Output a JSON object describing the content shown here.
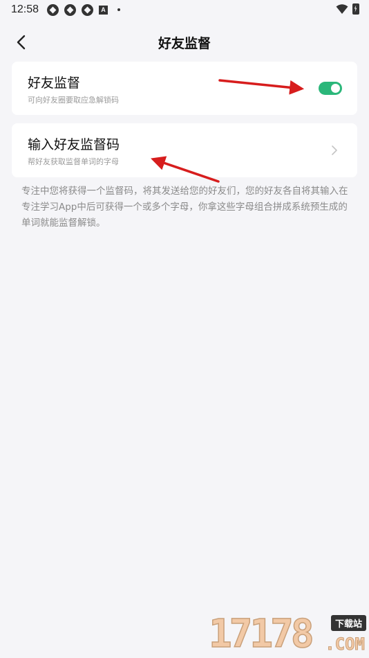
{
  "status_bar": {
    "time": "12:58",
    "icons": [
      "pin-icon",
      "pin-icon",
      "pin-icon",
      "a-icon",
      "dot-icon",
      "wifi-icon",
      "battery-icon"
    ],
    "a_glyph": "A"
  },
  "header": {
    "title": "好友监督",
    "back_icon": "chevron-left-icon"
  },
  "supervision_card": {
    "title": "好友监督",
    "subtitle": "可向好友圈要取应急解锁码",
    "toggle_on": true,
    "accent_color": "#2bb77a"
  },
  "enter_code_card": {
    "title": "输入好友监督码",
    "subtitle": "帮好友获取监督单词的字母",
    "icon": "chevron-right-icon"
  },
  "description": "专注中您将获得一个监督码，将其发送给您的好友们，您的好友各自将其输入在专注学习App中后可获得一个或多个字母，你拿这些字母组合拼成系统预生成的单词就能监督解锁。",
  "watermark": {
    "digits": "17178",
    "tag": "下载站",
    "suffix": ".COM"
  },
  "annotation_color": "#d71d1d"
}
